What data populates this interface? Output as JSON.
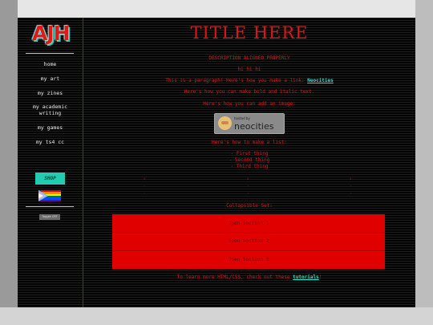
{
  "sidebar": {
    "logo": "AJH",
    "items": [
      {
        "label": "home"
      },
      {
        "label": "my art"
      },
      {
        "label": "my zines"
      },
      {
        "label": "my academic writing"
      },
      {
        "label": "my games"
      },
      {
        "label": "my ts4 cc"
      }
    ],
    "shop_label": "SHOP",
    "toggle_label": "Toggle CRT"
  },
  "main": {
    "title": "TITLE HERE",
    "description": "DESCRIPTION ALIGNED PROPERLY",
    "hi": "hi hi hi",
    "paragraph_text": "This is a paragraph! Here's how you make a link: ",
    "paragraph_link": "Neocities",
    "bold_italic": "Here's how you can make bold and italic text.",
    "image_intro": "Here's how you can add an image:",
    "neocities_badge": {
      "small": "hosted by",
      "big": "neocities"
    },
    "list_intro": "Here's how to make a list:",
    "list": [
      "- First thing",
      "- Second thing",
      "- Third thing"
    ],
    "collapsible_title": "Collapsible Set:",
    "sections": [
      "Open Section 1",
      "Open Section 2",
      "Open Section 3"
    ],
    "footer_text": "To learn more HTML/CSS, check out these ",
    "footer_link": "tutorials",
    "footer_end": "!"
  },
  "colors": {
    "accent": "#e21515",
    "link": "#2ee0c8",
    "shop": "#22ccb0",
    "section_bg": "#e00000"
  }
}
